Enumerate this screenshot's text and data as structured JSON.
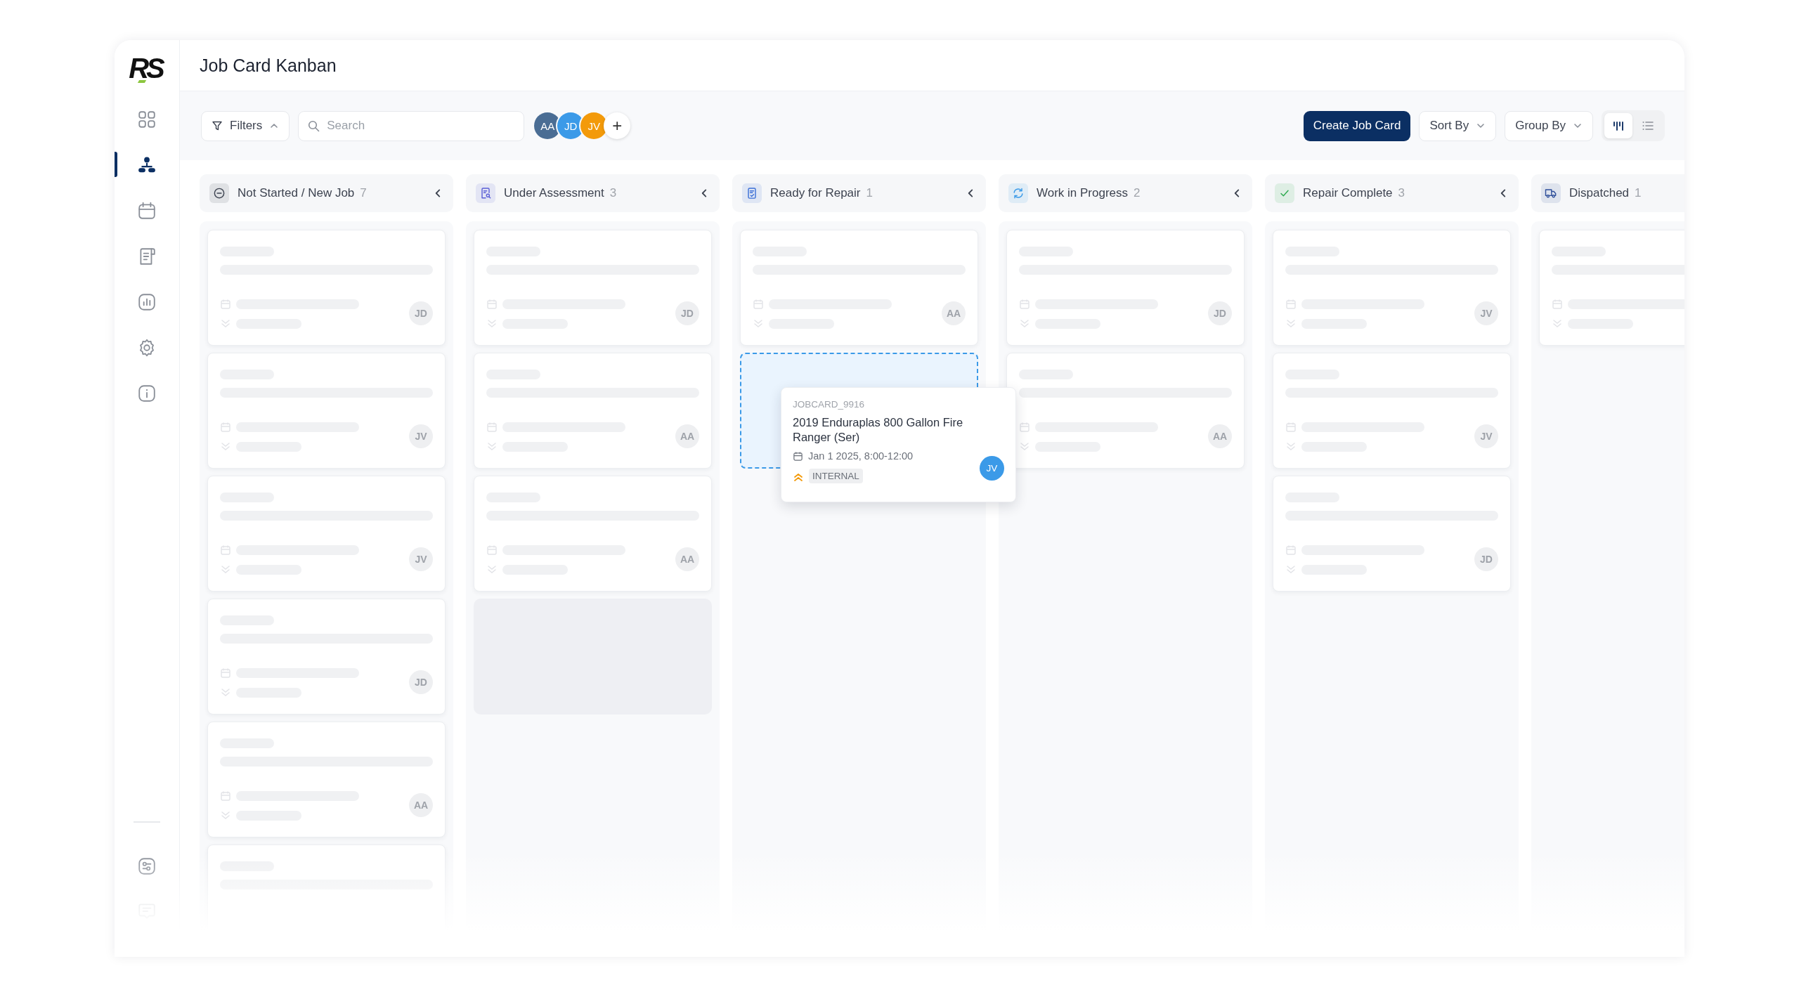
{
  "sidebar": {
    "logo": "RS",
    "nav": [
      {
        "selected": false
      },
      {
        "selected": true
      },
      {
        "selected": false
      },
      {
        "selected": false
      },
      {
        "selected": false
      },
      {
        "selected": false
      },
      {
        "selected": false
      }
    ],
    "bottom": [
      {
        "selected": false
      },
      {
        "selected": false
      }
    ]
  },
  "header": {
    "title": "Job Card Kanban"
  },
  "toolbar": {
    "filters": {
      "label": "Filters",
      "expanded": true
    },
    "search": {
      "placeholder": "Search"
    },
    "assignees": [
      {
        "initials": "AA",
        "color": "#4a6d94"
      },
      {
        "initials": "JD",
        "color": "#3b9ae8"
      },
      {
        "initials": "JV",
        "color": "#f39a0a"
      }
    ],
    "add_label": "+",
    "create_button": "Create Job Card",
    "sort": "Sort By",
    "group": "Group By",
    "views": [
      {
        "kind": "board",
        "selected": true
      },
      {
        "kind": "list",
        "selected": false
      }
    ]
  },
  "columns": [
    {
      "title": "Not Started / New Job",
      "count": "7",
      "color": "#3d4350",
      "cards": [
        {
          "kind": "skeleton",
          "assignee": "JD"
        },
        {
          "kind": "skeleton",
          "assignee": "JV"
        },
        {
          "kind": "skeleton",
          "assignee": "JV"
        },
        {
          "kind": "skeleton",
          "assignee": "JD"
        },
        {
          "kind": "skeleton",
          "assignee": "AA"
        },
        {
          "kind": "partial"
        }
      ]
    },
    {
      "title": "Under Assessment",
      "count": "3",
      "color": "#5b5fd6",
      "cards": [
        {
          "kind": "skeleton",
          "assignee": "JD"
        },
        {
          "kind": "skeleton",
          "assignee": "AA"
        },
        {
          "kind": "skeleton",
          "assignee": "AA"
        },
        {
          "kind": "placeholder"
        }
      ]
    },
    {
      "title": "Ready for Repair",
      "count": "1",
      "color": "#3b6fd6",
      "cards": [
        {
          "kind": "skeleton",
          "assignee": "AA"
        },
        {
          "kind": "dropzone",
          "dragged_card": {
            "id": "JOBCARD_9916",
            "title": "2019 Enduraplas 800 Gallon Fire Ranger (Ser)",
            "schedule": "Jan 1 2025, 8:00-12:00",
            "tag": "INTERNAL",
            "assignee": "JV"
          }
        }
      ]
    },
    {
      "title": "Work in Progress",
      "count": "2",
      "color": "#3b9ae8",
      "cards": [
        {
          "kind": "skeleton",
          "assignee": "JD"
        },
        {
          "kind": "skeleton",
          "assignee": "AA"
        }
      ]
    },
    {
      "title": "Repair Complete",
      "count": "3",
      "color": "#2eaa4f",
      "cards": [
        {
          "kind": "skeleton",
          "assignee": "JV"
        },
        {
          "kind": "skeleton",
          "assignee": "JV"
        },
        {
          "kind": "skeleton",
          "assignee": "JD"
        }
      ]
    },
    {
      "title": "Dispatched",
      "count": "1",
      "color": "#2f4f9a",
      "cards": [
        {
          "kind": "skeleton"
        }
      ]
    }
  ]
}
